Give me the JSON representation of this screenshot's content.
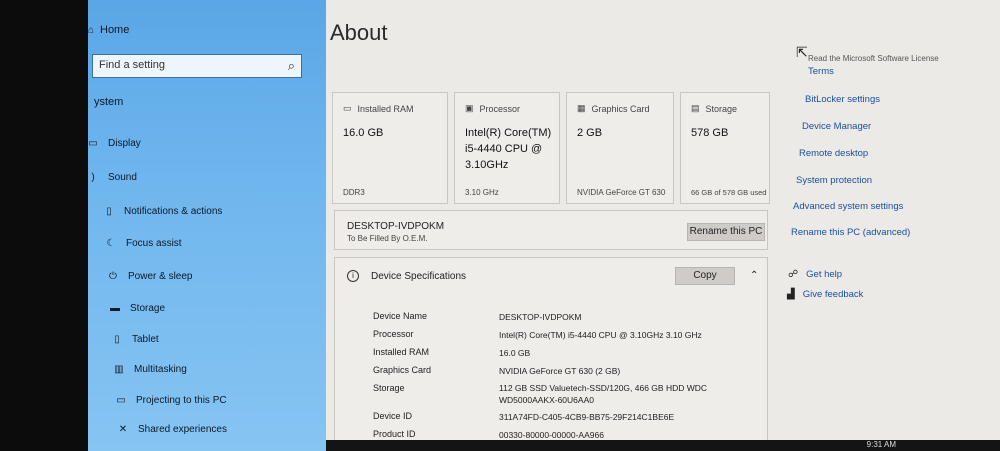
{
  "sidebar": {
    "home": "Home",
    "search_placeholder": "Find a setting",
    "section": "ystem",
    "items": [
      {
        "label": "Display",
        "icon": "display-icon"
      },
      {
        "label": "Sound",
        "icon": "sound-icon"
      },
      {
        "label": "Notifications & actions",
        "icon": "notifications-icon"
      },
      {
        "label": "Focus assist",
        "icon": "focus-assist-icon"
      },
      {
        "label": "Power & sleep",
        "icon": "power-icon"
      },
      {
        "label": "Storage",
        "icon": "storage-icon"
      },
      {
        "label": "Tablet",
        "icon": "tablet-icon"
      },
      {
        "label": "Multitasking",
        "icon": "multitasking-icon"
      },
      {
        "label": "Projecting to this PC",
        "icon": "projecting-icon"
      },
      {
        "label": "Shared experiences",
        "icon": "shared-icon"
      }
    ]
  },
  "main": {
    "title": "About",
    "cards": [
      {
        "header": "Installed RAM",
        "value": "16.0 GB",
        "foot": "DDR3",
        "icon": "ram-icon"
      },
      {
        "header": "Processor",
        "value": "Intel(R) Core(TM) i5-4440 CPU @ 3.10GHz",
        "foot": "3.10 GHz",
        "icon": "processor-icon"
      },
      {
        "header": "Graphics Card",
        "value": "2 GB",
        "foot": "NVIDIA GeForce GT 630",
        "icon": "graphics-card-icon"
      },
      {
        "header": "Storage",
        "value": "578 GB",
        "foot": "66 GB of 578 GB used",
        "icon": "storage-drive-icon"
      }
    ],
    "pc_name": "DESKTOP-IVDPOKM",
    "pc_sub": "To Be Filled By O.E.M.",
    "rename_button": "Rename this PC",
    "spec_title": "Device Specifications",
    "copy_button": "Copy",
    "specs": [
      {
        "label": "Device Name",
        "value": "DESKTOP-IVDPOKM"
      },
      {
        "label": "Processor",
        "value": "Intel(R) Core(TM) i5-4440 CPU @ 3.10GHz   3.10 GHz"
      },
      {
        "label": "Installed RAM",
        "value": "16.0 GB"
      },
      {
        "label": "Graphics Card",
        "value": "NVIDIA GeForce GT 630 (2 GB)"
      },
      {
        "label": "Storage",
        "value": "112  GB  SSD  Valuetech-SSD/120G,  466  GB  HDD  WDC WD5000AAKX-60U6AA0"
      },
      {
        "label": "Device ID",
        "value": "311A74FD-C405-4CB9-BB75-29F214C1BE6E"
      },
      {
        "label": "Product ID",
        "value": "00330-80000-00000-AA966"
      }
    ]
  },
  "right": {
    "truncated_link": "Read the Microsoft Software License",
    "links": [
      "Terms",
      "BitLocker settings",
      "Device Manager",
      "Remote desktop",
      "System protection",
      "Advanced system settings",
      "Rename this PC (advanced)"
    ],
    "get_help": "Get help",
    "give_feedback": "Give feedback"
  },
  "taskbar": {
    "clock": "9:31 AM"
  }
}
